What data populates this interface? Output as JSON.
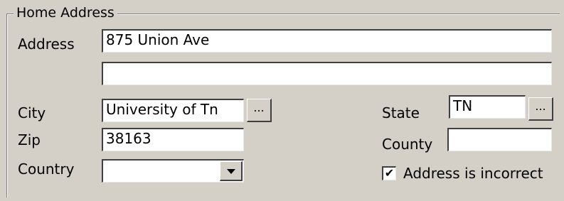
{
  "group": {
    "legend": "Home Address"
  },
  "fields": {
    "address_label": "Address",
    "address_line1": "875 Union Ave",
    "address_line2": "",
    "city_label": "City",
    "city": "University of Tn",
    "zip_label": "Zip",
    "zip": "38163",
    "country_label": "Country",
    "country": "",
    "state_label": "State",
    "state": "TN",
    "county_label": "County",
    "county": ""
  },
  "buttons": {
    "city_lookup": "...",
    "state_lookup": "..."
  },
  "checkbox": {
    "address_incorrect_label": "Address is incorrect",
    "checked": true,
    "mark": "✔"
  },
  "icons": {
    "dropdown": "chevron-down-icon"
  }
}
